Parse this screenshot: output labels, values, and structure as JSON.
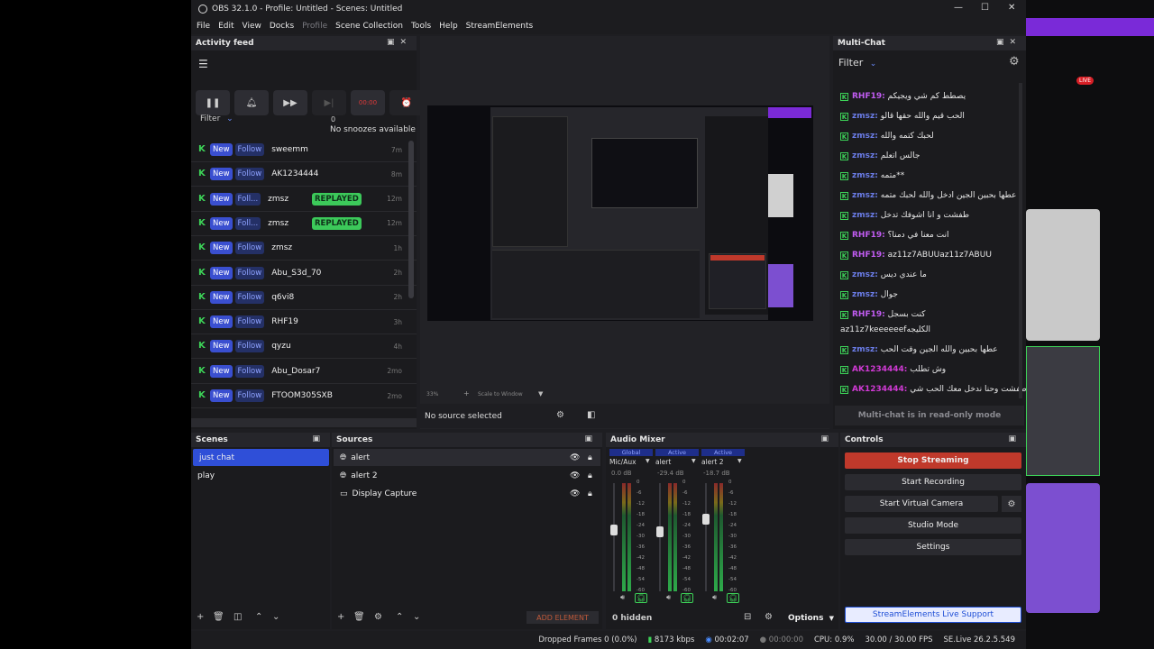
{
  "window": {
    "title": "OBS 32.1.0 - Profile: Untitled - Scenes: Untitled"
  },
  "menu": [
    "File",
    "Edit",
    "View",
    "Docks",
    "Profile",
    "Scene Collection",
    "Tools",
    "Help",
    "StreamElements"
  ],
  "activity_feed": {
    "title": "Activity feed",
    "filter_label": "Filter",
    "timer_value": "00:00",
    "snooze_count": "0",
    "snooze_text": "No snoozes available",
    "items": [
      {
        "new": "New",
        "type": "Follow",
        "name": "sweemm",
        "replayed": "",
        "time": "7m"
      },
      {
        "new": "New",
        "type": "Follow",
        "name": "AK1234444",
        "replayed": "",
        "time": "8m"
      },
      {
        "new": "New",
        "type": "Foll...",
        "name": "zmsz",
        "replayed": "REPLAYED",
        "time": "12m"
      },
      {
        "new": "New",
        "type": "Foll...",
        "name": "zmsz",
        "replayed": "REPLAYED",
        "time": "12m"
      },
      {
        "new": "New",
        "type": "Follow",
        "name": "zmsz",
        "replayed": "",
        "time": "1h"
      },
      {
        "new": "New",
        "type": "Follow",
        "name": "Abu_S3d_70",
        "replayed": "",
        "time": "2h"
      },
      {
        "new": "New",
        "type": "Follow",
        "name": "q6vi8",
        "replayed": "",
        "time": "2h"
      },
      {
        "new": "New",
        "type": "Follow",
        "name": "RHF19",
        "replayed": "",
        "time": "3h"
      },
      {
        "new": "New",
        "type": "Follow",
        "name": "qyzu",
        "replayed": "",
        "time": "4h"
      },
      {
        "new": "New",
        "type": "Follow",
        "name": "Abu_Dosar7",
        "replayed": "",
        "time": "2mo"
      },
      {
        "new": "New",
        "type": "Follow",
        "name": "FTOOM305SXB",
        "replayed": "",
        "time": "2mo"
      }
    ]
  },
  "preview": {
    "zoom": "33%",
    "scale_mode": "Scale to Window",
    "no_source": "No source selected"
  },
  "multichat": {
    "title": "Multi-Chat",
    "filter_label": "Filter",
    "readonly_text": "Multi-chat is in read-only mode",
    "messages": [
      {
        "user": "RHF19:",
        "cls": "u-rhf",
        "text": "يصطط كم شي ويجيكم"
      },
      {
        "user": "zmsz:",
        "cls": "u-zmsz",
        "text": "الحب قيم والله حقها قالو"
      },
      {
        "user": "zmsz:",
        "cls": "u-zmsz",
        "text": "لحبك كتمه والله"
      },
      {
        "user": "zmsz:",
        "cls": "u-zmsz",
        "text": "جالس اتعلم"
      },
      {
        "user": "zmsz:",
        "cls": "u-zmsz",
        "text": "متمه**"
      },
      {
        "user": "zmsz:",
        "cls": "u-zmsz",
        "text": "عطها بحبين الجين ادخل والله لحبك متمه"
      },
      {
        "user": "zmsz:",
        "cls": "u-zmsz",
        "text": "طفشت و انا اشوفك تدخل"
      },
      {
        "user": "RHF19:",
        "cls": "u-rhf",
        "text": "انت معنا في دمنا؟"
      },
      {
        "user": "RHF19:",
        "cls": "u-rhf",
        "text": "az11z7ABUUaz11z7ABUU"
      },
      {
        "user": "zmsz:",
        "cls": "u-zmsz",
        "text": "ما عندي ديس"
      },
      {
        "user": "zmsz:",
        "cls": "u-zmsz",
        "text": "جوال"
      },
      {
        "user": "RHF19:",
        "cls": "u-rhf",
        "text": "كنت بسجل"
      },
      {
        "user": "",
        "cls": "",
        "text": "az11z7keeeeeefالكليجه"
      },
      {
        "user": "zmsz:",
        "cls": "u-zmsz",
        "text": "عطها بحبين والله الجين وقت الحب"
      },
      {
        "user": "AK1234444:",
        "cls": "u-ak",
        "text": "وش تطلب"
      },
      {
        "user": "AK1234444:",
        "cls": "u-ak",
        "text": "طفشت وحنا ندخل معك الحب شي"
      }
    ]
  },
  "scenes": {
    "title": "Scenes",
    "items": [
      "just chat",
      "play"
    ]
  },
  "sources": {
    "title": "Sources",
    "items": [
      "alert",
      "alert 2",
      "Display Capture"
    ],
    "add_element": "ADD ELEMENT"
  },
  "mixer": {
    "title": "Audio Mixer",
    "channels": [
      {
        "badge": "Global",
        "name": "Mic/Aux",
        "db": "0.0 dB",
        "level": 0.62
      },
      {
        "badge": "Active",
        "name": "alert",
        "db": "-29.4 dB",
        "level": 0.6
      },
      {
        "badge": "Active",
        "name": "alert 2",
        "db": "-18.7 dB",
        "level": 0.72
      }
    ],
    "scale": [
      "0",
      "-6",
      "-12",
      "-18",
      "-24",
      "-30",
      "-36",
      "-42",
      "-48",
      "-54",
      "-60"
    ],
    "hidden": "0 hidden",
    "options": "Options"
  },
  "controls": {
    "title": "Controls",
    "stop_streaming": "Stop Streaming",
    "start_recording": "Start Recording",
    "start_virtual_camera": "Start Virtual Camera",
    "studio_mode": "Studio Mode",
    "settings": "Settings",
    "se_support": "StreamElements Live Support"
  },
  "status": {
    "dropped": "Dropped Frames 0 (0.0%)",
    "bitrate": "8173 kbps",
    "stream_time": "00:02:07",
    "rec_time": "00:00:00",
    "cpu": "CPU: 0.9%",
    "fps": "30.00 / 30.00 FPS",
    "version": "SE.Live 26.2.5.549"
  },
  "colors": {
    "accent_blue": "#3a4fd0",
    "stop_red": "#c0392b",
    "kick_green": "#3dd458",
    "se_blue": "#1f4fd6"
  }
}
